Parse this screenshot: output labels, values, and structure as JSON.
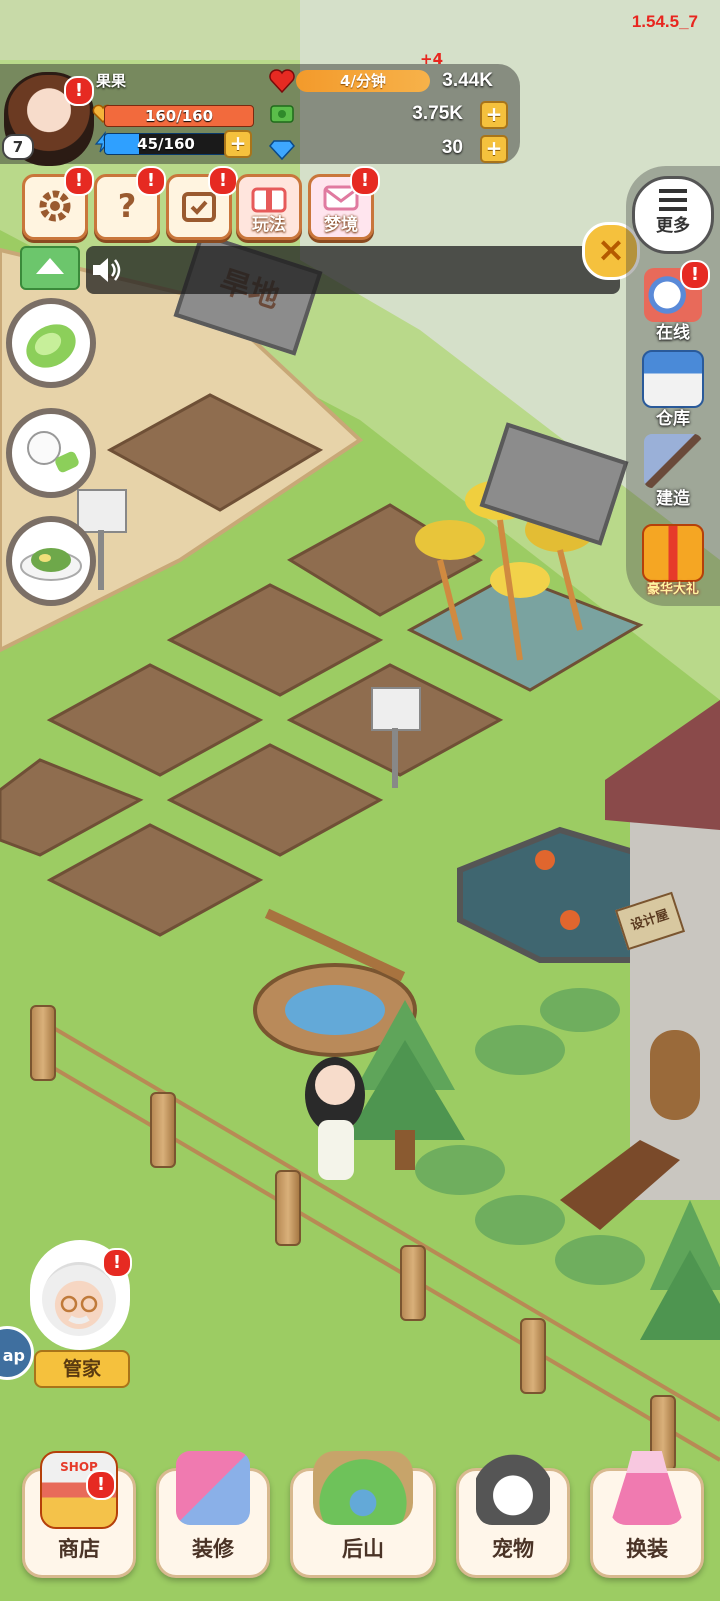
{
  "version": "1.54.5_7",
  "player": {
    "name": "果果",
    "level": "7",
    "hp": "160/160",
    "energy": "45/160",
    "energy_fraction": 0.28
  },
  "resources": {
    "heart_rate": "4/分钟",
    "heart_rate_bonus": "+4",
    "hearts": "3.44K",
    "cash": "3.75K",
    "gems": "30"
  },
  "badge_mark": "!",
  "plus_mark": "+",
  "menu": {
    "settings_icon": "gear-icon",
    "help_glyph": "?",
    "calendar_icon": "calendar-icon",
    "gameplay_label": "玩法",
    "dream_label": "梦境"
  },
  "notice": {
    "speaker_icon": "speaker-icon"
  },
  "close_glyph": "×",
  "side_menu": {
    "more_label": "更多",
    "online_label": "在线",
    "warehouse_label": "仓库",
    "build_label": "建造",
    "gift_label": "豪华大礼"
  },
  "scene": {
    "drylands_sign": "旱地",
    "designer_sign": "设计屋"
  },
  "butler": {
    "label": "管家",
    "edge_tab": "ap"
  },
  "bottom_nav": {
    "shop_label": "商店",
    "shop_sign": "SHOP",
    "decorate_label": "装修",
    "mountain_label": "后山",
    "pet_label": "宠物",
    "outfit_label": "换装"
  },
  "colors": {
    "grass": "#b9d98a",
    "soil": "#8f6d4f",
    "accent": "#f5c13d",
    "alert": "#e62a22"
  }
}
